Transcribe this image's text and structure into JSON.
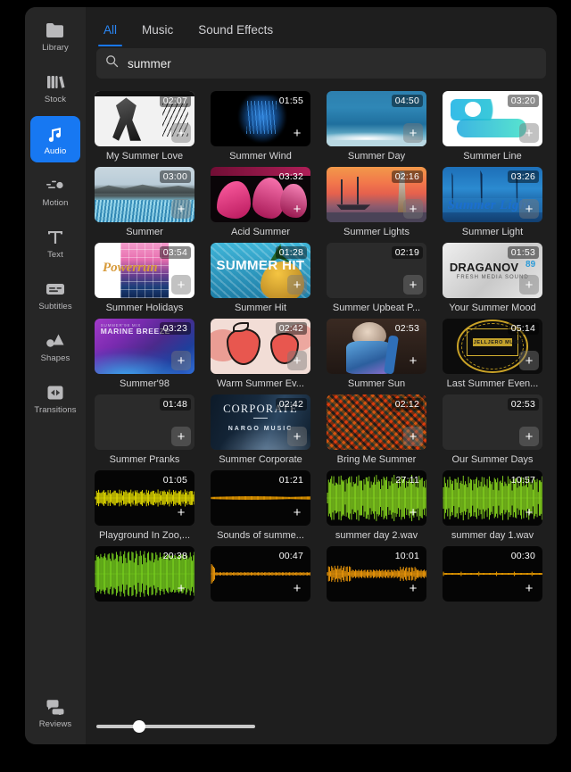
{
  "sidebar": {
    "items": [
      {
        "label": "Library",
        "icon": "folder-icon",
        "active": false
      },
      {
        "label": "Stock",
        "icon": "stock-books-icon",
        "active": false
      },
      {
        "label": "Audio",
        "icon": "music-note-icon",
        "active": true
      },
      {
        "label": "Motion",
        "icon": "motion-slider-icon",
        "active": false
      },
      {
        "label": "Text",
        "icon": "text-t-icon",
        "active": false
      },
      {
        "label": "Subtitles",
        "icon": "subtitles-icon",
        "active": false
      },
      {
        "label": "Shapes",
        "icon": "shapes-icon",
        "active": false
      },
      {
        "label": "Transitions",
        "icon": "transitions-icon",
        "active": false
      }
    ],
    "bottom": {
      "label": "Reviews",
      "icon": "chat-bubbles-icon"
    }
  },
  "tabs": [
    {
      "label": "All",
      "active": true
    },
    {
      "label": "Music",
      "active": false
    },
    {
      "label": "Sound Effects",
      "active": false
    }
  ],
  "search": {
    "value": "summer",
    "placeholder": "Search",
    "icon": "search-icon"
  },
  "accent_color": "#1778f2",
  "add_button_label": "+",
  "slider": {
    "value": 25
  },
  "results": [
    {
      "title": "My Summer Love",
      "duration": "02:07",
      "art": "my-summer-love"
    },
    {
      "title": "Summer Wind",
      "duration": "01:55",
      "art": "summer-wind"
    },
    {
      "title": "Summer Day",
      "duration": "04:50",
      "art": "summer-day"
    },
    {
      "title": "Summer Line",
      "duration": "03:20",
      "art": "summer-line"
    },
    {
      "title": "Summer",
      "duration": "03:00",
      "art": "summer-glacier"
    },
    {
      "title": "Acid Summer",
      "duration": "03:32",
      "art": "acid-summer"
    },
    {
      "title": "Summer Lights",
      "duration": "02:16",
      "art": "summer-lights"
    },
    {
      "title": "Summer Light",
      "duration": "03:26",
      "art": "summer-light"
    },
    {
      "title": "Summer Holidays",
      "duration": "03:54",
      "art": "summer-holidays"
    },
    {
      "title": "Summer Hit",
      "duration": "01:28",
      "art": "summer-hit"
    },
    {
      "title": "Summer Upbeat P...",
      "duration": "02:19",
      "art": "blank"
    },
    {
      "title": "Your Summer Mood",
      "duration": "01:53",
      "art": "draganov"
    },
    {
      "title": "Summer'98",
      "duration": "03:23",
      "art": "marine-breeze"
    },
    {
      "title": "Warm Summer Ev...",
      "duration": "02:42",
      "art": "strawberries"
    },
    {
      "title": "Summer Sun",
      "duration": "02:53",
      "art": "summer-sun"
    },
    {
      "title": "Last Summer Even...",
      "duration": "05:14",
      "art": "jelljero"
    },
    {
      "title": "Summer Pranks",
      "duration": "01:48",
      "art": "blank"
    },
    {
      "title": "Summer Corporate",
      "duration": "02:42",
      "art": "corporate"
    },
    {
      "title": "Bring Me Summer",
      "duration": "02:12",
      "art": "bring-me-summer"
    },
    {
      "title": "Our Summer Days",
      "duration": "02:53",
      "art": "blank"
    },
    {
      "title": "Playground In Zoo,...",
      "duration": "01:05",
      "art": "wave-yellow-small"
    },
    {
      "title": "Sounds of summe...",
      "duration": "01:21",
      "art": "wave-orange-flat"
    },
    {
      "title": "summer day 2.wav",
      "duration": "27:11",
      "art": "wave-green-loud"
    },
    {
      "title": "summer day 1.wav",
      "duration": "10:57",
      "art": "wave-green-loud2"
    },
    {
      "title": "",
      "duration": "20:38",
      "art": "wave-green-loud3"
    },
    {
      "title": "",
      "duration": "00:47",
      "art": "wave-orange-spike"
    },
    {
      "title": "",
      "duration": "10:01",
      "art": "wave-orange-mid"
    },
    {
      "title": "",
      "duration": "00:30",
      "art": "wave-orange-line"
    }
  ]
}
